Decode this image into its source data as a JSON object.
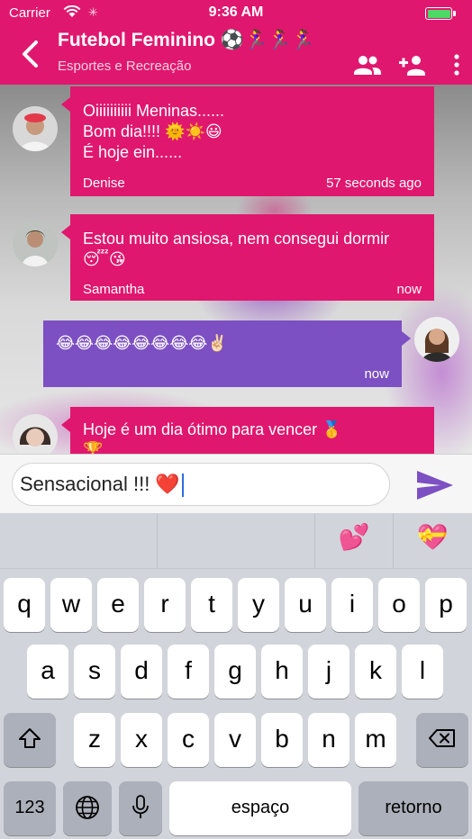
{
  "status_bar": {
    "carrier": "Carrier",
    "time": "9:36 AM"
  },
  "header": {
    "title": "Futebol Feminino ⚽🏃‍♀️🏃‍♀️🏃‍♀️",
    "subtitle": "Esportes e Recreação",
    "colors": {
      "header_bg": "#e0176e",
      "incoming_bubble": "#e0176e",
      "outgoing_bubble": "#7c50c2",
      "send_icon": "#7c50c2"
    }
  },
  "messages": [
    {
      "direction": "in",
      "text": "Oiiiiiiiiii Meninas......\nBom dia!!!! 🌞☀️😃\nÉ hoje ein......",
      "sender": "Denise",
      "time": "57 seconds ago"
    },
    {
      "direction": "in",
      "text": "Estou muito ansiosa, nem consegui dormir 😴😘",
      "sender": "Samantha",
      "time": "now"
    },
    {
      "direction": "out",
      "text": "😂😂😂😂😂😂😂😂✌🏻",
      "time": "now"
    },
    {
      "direction": "in",
      "text": "Hoje é um dia ótimo para vencer 🥇\n🏆"
    }
  ],
  "composer": {
    "value": "Sensacional !!! ❤️"
  },
  "keyboard": {
    "predictions": [
      "",
      "",
      "💕",
      "💝"
    ],
    "row1": [
      "q",
      "w",
      "e",
      "r",
      "t",
      "y",
      "u",
      "i",
      "o",
      "p"
    ],
    "row2": [
      "a",
      "s",
      "d",
      "f",
      "g",
      "h",
      "j",
      "k",
      "l"
    ],
    "row3": [
      "z",
      "x",
      "c",
      "v",
      "b",
      "n",
      "m"
    ],
    "numbers_key": "123",
    "space_key": "espaço",
    "return_key": "retorno"
  },
  "icons": [
    "back-chevron-icon",
    "members-icon",
    "add-member-icon",
    "more-vertical-icon",
    "send-icon",
    "shift-icon",
    "backspace-icon",
    "globe-icon",
    "microphone-icon",
    "wifi-icon",
    "battery-icon",
    "sent-check-icon"
  ]
}
